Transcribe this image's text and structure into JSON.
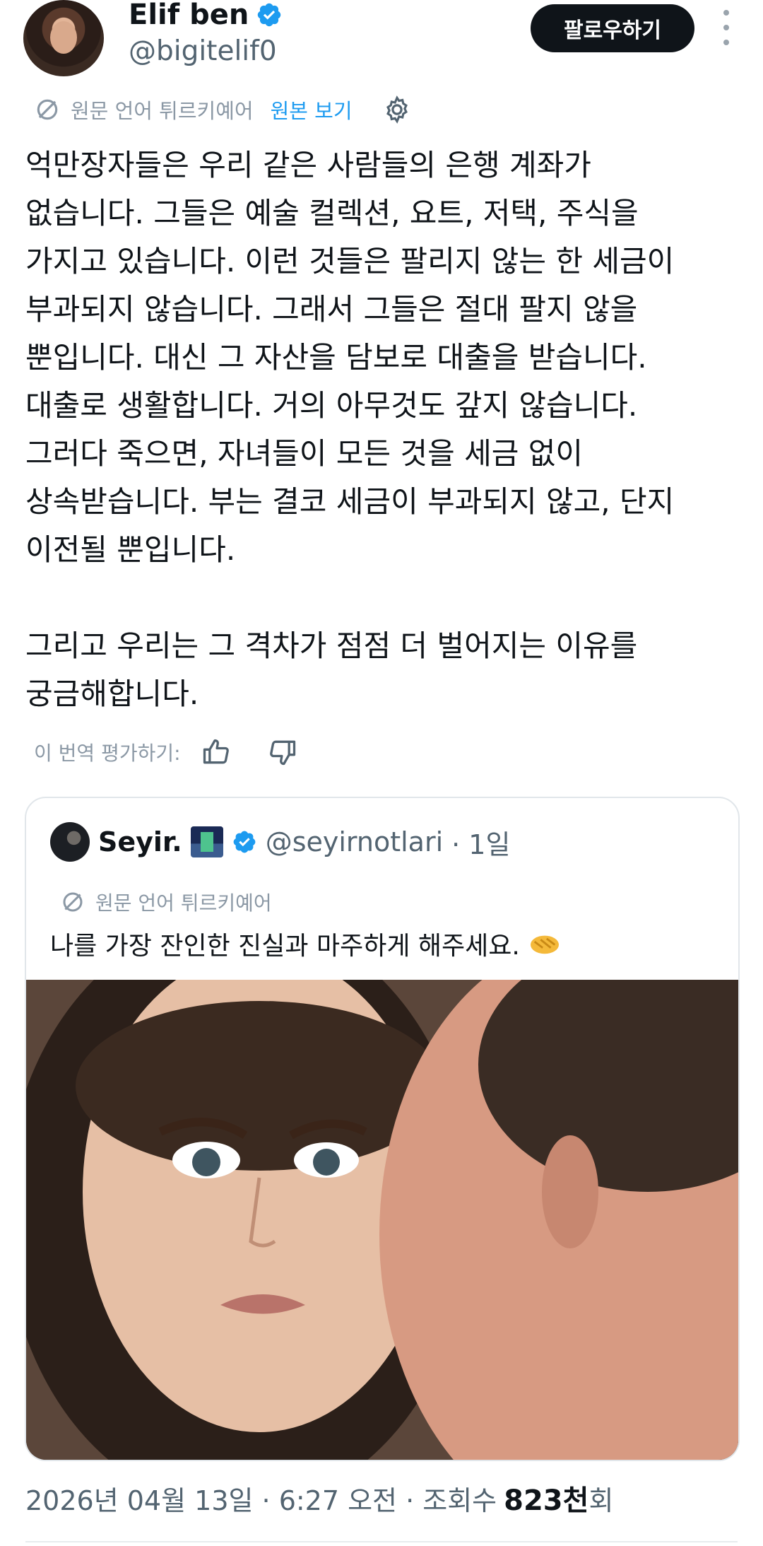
{
  "author": {
    "display_name": "Elif ben",
    "handle": "@bigitelif0",
    "verified": true
  },
  "actions": {
    "follow_label": "팔로우하기",
    "more_icon": "more-vertical-icon"
  },
  "translation": {
    "label": "원문 언어 튀르키예어",
    "show_original": "원본 보기",
    "settings_icon": "gear-icon"
  },
  "tweet": {
    "text": "억만장자들은 우리 같은 사람들의 은행 계좌가\n없습니다. 그들은 예술 컬렉션, 요트, 저택, 주식을\n가지고 있습니다. 이런 것들은 팔리지 않는 한 세금이\n부과되지 않습니다. 그래서 그들은 절대 팔지 않을\n뿐입니다. 대신 그 자산을 담보로 대출을 받습니다.\n대출로 생활합니다. 거의 아무것도 갚지 않습니다.\n그러다 죽으면, 자녀들이 모든 것을 세금 없이\n상속받습니다. 부는 결코 세금이 부과되지 않고, 단지\n이전될 뿐입니다.\n\n그리고 우리는 그 격차가 점점 더 벌어지는 이유를\n궁금해합니다."
  },
  "rating": {
    "label": "이 번역 평가하기:"
  },
  "quote": {
    "name": "Seyir.",
    "handle": "@seyirnotlari",
    "time": "· 1일",
    "translation_label": "원문 언어 튀르키예어",
    "text": "나를 가장 잔인한 진실과 마주하게 해주세요."
  },
  "meta": {
    "date": "2026년 04월 13일 · 6:27 오전 · 조회수",
    "views": "823천",
    "views_suffix": "회"
  },
  "colors": {
    "link": "#1d9bf0",
    "verified": "#1d9bf0",
    "muted": "#536471",
    "text": "#0f1419"
  }
}
